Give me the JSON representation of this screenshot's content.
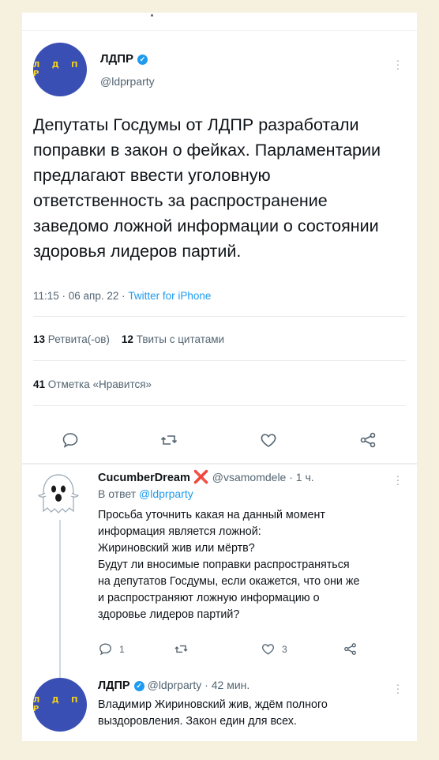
{
  "tweet": {
    "display_name": "ЛДПР",
    "handle": "@ldprparty",
    "avatar_logo": "Л Д П Р",
    "text": "Депутаты Госдумы от ЛДПР разработали поправки в закон о фейках. Парламентарии предлагают ввести уголовную ответственность за распространение заведомо ложной информации о состоянии здоровья лидеров партий.",
    "time": "11:15 · 06 апр. 22 · ",
    "source": "Twitter for iPhone",
    "retweets_count": "13",
    "retweets_label": "Ретвита(-ов)",
    "quotes_count": "12",
    "quotes_label": "Твиты с цитатами",
    "likes_count": "41",
    "likes_label": "Отметка «Нравится»"
  },
  "reply1": {
    "display_name": "CucumberDream",
    "flag": "❌",
    "handle": "@vsamomdele · 1 ч.",
    "reply_to_prefix": "В ответ ",
    "reply_to_mention": "@ldprparty",
    "text_lines": [
      "Просьба уточнить какая на данный момент",
      "информация является ложной:",
      "Жириновский жив или мёртв?",
      "Будут ли вносимые поправки распространяться",
      "на депутатов Госдумы, если окажется, что они же",
      "и распространяют ложную информацию о",
      "здоровье лидеров партий?"
    ],
    "reply_count": "1",
    "like_count": "3"
  },
  "reply2": {
    "display_name": "ЛДПР",
    "handle": "@ldprparty · 42 мин.",
    "text_lines": [
      "Владимир Жириновский жив, ждём полного",
      "выздоровления. Закон един для всех."
    ]
  },
  "colors": {
    "accent": "#1d9bf0",
    "avatar_bg": "#3a4fb4",
    "logo": "#f4d21f",
    "background": "#f6f1de"
  },
  "icons": [
    "reply-icon",
    "retweet-icon",
    "like-icon",
    "share-icon",
    "verified-icon",
    "more-icon"
  ]
}
